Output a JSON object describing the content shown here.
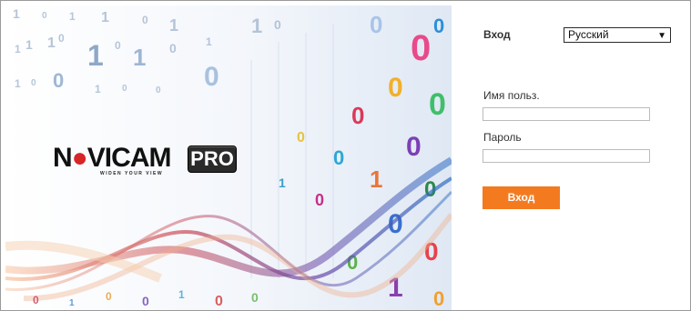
{
  "logo": {
    "brand_part1": "N",
    "brand_o": "●",
    "brand_part2": "VI",
    "brand_part3": "CAM",
    "tagline": "WIDEN YOUR VIEW",
    "badge": "PRO"
  },
  "login": {
    "title": "Вход",
    "language": "Русский",
    "username_label": "Имя польз.",
    "username_value": "",
    "password_label": "Пароль",
    "password_value": "",
    "submit_label": "Вход"
  },
  "colors": {
    "accent": "#f47a20",
    "brand_red": "#d62628"
  }
}
